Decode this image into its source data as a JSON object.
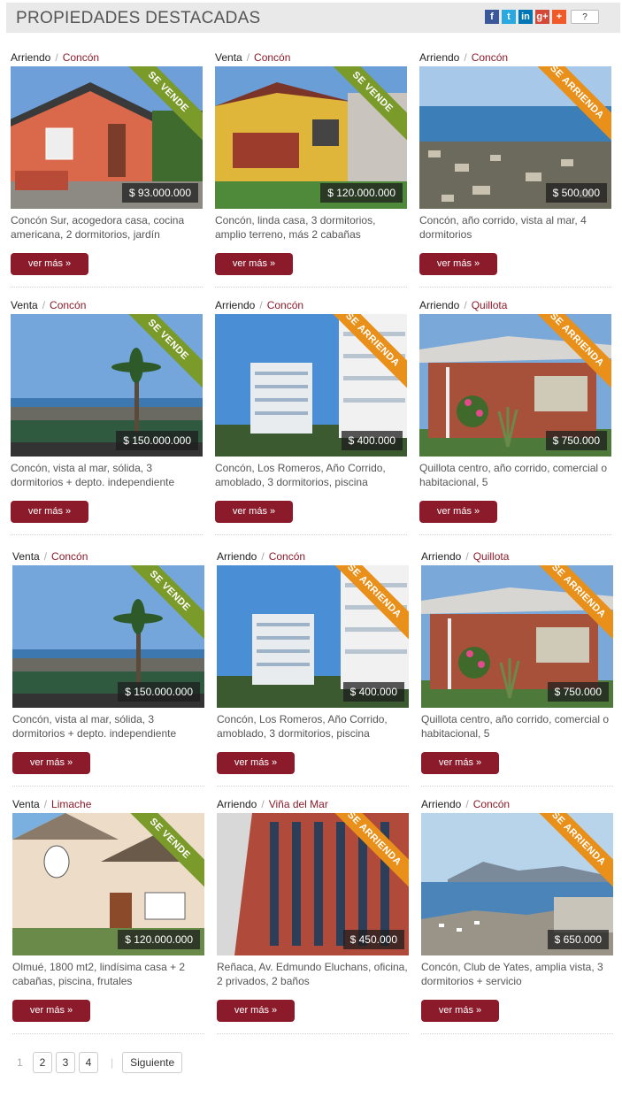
{
  "header": {
    "title": "PROPIEDADES DESTACADAS",
    "share_count": "?"
  },
  "social": [
    {
      "icon": "facebook-icon",
      "glyph": "f",
      "color": "#3b5998"
    },
    {
      "icon": "twitter-icon",
      "glyph": "t",
      "color": "#2aa9e0"
    },
    {
      "icon": "linkedin-icon",
      "glyph": "in",
      "color": "#0077b5"
    },
    {
      "icon": "googleplus-icon",
      "glyph": "g+",
      "color": "#d34836"
    },
    {
      "icon": "addthis-icon",
      "glyph": "+",
      "color": "#f05a28"
    }
  ],
  "more_label": "ver más »",
  "cards": [
    {
      "type": "Arriendo",
      "location": "Concón",
      "ribbon": "SE VENDE",
      "price": "$ 93.000.000",
      "desc": "Concón Sur, acogedora casa, cocina americana, 2 dormitorios, jardín",
      "scene": "house-orange"
    },
    {
      "type": "Venta",
      "location": "Concón",
      "ribbon": "SE VENDE",
      "price": "$ 120.000.000",
      "desc": "Concón, linda casa, 3 dormitorios, amplio terreno, más 2 cabañas",
      "scene": "house-yellow"
    },
    {
      "type": "Arriendo",
      "location": "Concón",
      "ribbon": "SE ARRIENDA",
      "price": "$ 500.000",
      "desc": "Concón, año corrido, vista al mar, 4 dormitorios",
      "scene": "aerial-sea"
    },
    {
      "type": "Venta",
      "location": "Concón",
      "ribbon": "SE VENDE",
      "price": "$ 150.000.000",
      "desc": "Concón, vista al mar, sólida, 3 dormitorios + depto. independiente",
      "scene": "palm-view"
    },
    {
      "type": "Arriendo",
      "location": "Concón",
      "ribbon": "SE ARRIENDA",
      "price": "$ 400.000",
      "desc": "Concón, Los Romeros, Año Corrido, amoblado, 3 dormitorios, piscina",
      "scene": "apartments"
    },
    {
      "type": "Arriendo",
      "location": "Quillota",
      "ribbon": "SE ARRIENDA",
      "price": "$ 750.000",
      "desc": "Quillota centro, año corrido, comercial o habitacional, 5",
      "scene": "house-garden"
    },
    {
      "type": "Venta",
      "location": "Concón",
      "ribbon": "SE VENDE",
      "price": "$ 150.000.000",
      "desc": "Concón, vista al mar, sólida, 3 dormitorios + depto. independiente",
      "scene": "palm-view"
    },
    {
      "type": "Arriendo",
      "location": "Concón",
      "ribbon": "SE ARRIENDA",
      "price": "$ 400.000",
      "desc": "Concón, Los Romeros, Año Corrido, amoblado, 3 dormitorios, piscina",
      "scene": "apartments"
    },
    {
      "type": "Arriendo",
      "location": "Quillota",
      "ribbon": "SE ARRIENDA",
      "price": "$ 750.000",
      "desc": "Quillota centro, año corrido, comercial o habitacional, 5",
      "scene": "house-garden"
    },
    {
      "type": "Venta",
      "location": "Limache",
      "ribbon": "SE VENDE",
      "price": "$ 120.000.000",
      "desc": "Olmué, 1800 mt2, lindísima casa + 2 cabañas, piscina, frutales",
      "scene": "house-cream"
    },
    {
      "type": "Arriendo",
      "location": "Viña del Mar",
      "ribbon": "SE ARRIENDA",
      "price": "$ 450.000",
      "desc": "Reñaca, Av. Edmundo Eluchans, oficina, 2 privados, 2 baños",
      "scene": "tower"
    },
    {
      "type": "Arriendo",
      "location": "Concón",
      "ribbon": "SE ARRIENDA",
      "price": "$ 650.000",
      "desc": "Concón, Club de Yates, amplia vista, 3 dormitorios + servicio",
      "scene": "bay-view"
    }
  ],
  "pagination": {
    "current": "1",
    "pages": [
      "2",
      "3",
      "4"
    ],
    "next": "Siguiente"
  }
}
